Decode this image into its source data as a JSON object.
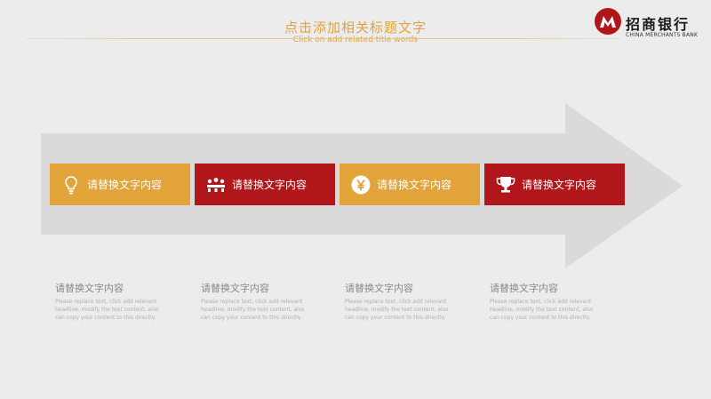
{
  "header": {
    "title": "点击添加相关标题文字",
    "subtitle": "Click on add related title words"
  },
  "logo": {
    "name_cn": "招商银行",
    "name_en": "CHINA MERCHANTS BANK",
    "brand_color": "#b0161a"
  },
  "colors": {
    "orange": "#e2a33a",
    "red": "#b0161a",
    "band": "#dadada",
    "background": "#ececec"
  },
  "steps": [
    {
      "label": "请替换文字内容",
      "icon": "lightbulb-icon",
      "color": "orange"
    },
    {
      "label": "请替换文字内容",
      "icon": "meeting-icon",
      "color": "red"
    },
    {
      "label": "请替换文字内容",
      "icon": "yen-coin-icon",
      "color": "orange"
    },
    {
      "label": "请替换文字内容",
      "icon": "trophy-icon",
      "color": "red"
    }
  ],
  "descriptions": [
    {
      "heading": "请替换文字内容",
      "body": "Please replace text, click add relevant headline, modify the text content, also can copy your content to this directly."
    },
    {
      "heading": "请替换文字内容",
      "body": "Please replace text, click add relevant headline, modify the text content, also can copy your content to this directly."
    },
    {
      "heading": "请替换文字内容",
      "body": "Please replace text, click add relevant headline, modify the text content, also can copy your content to this directly."
    },
    {
      "heading": "请替换文字内容",
      "body": "Please replace text, click add relevant headline, modify the text content, also can copy your content to this directly."
    }
  ]
}
